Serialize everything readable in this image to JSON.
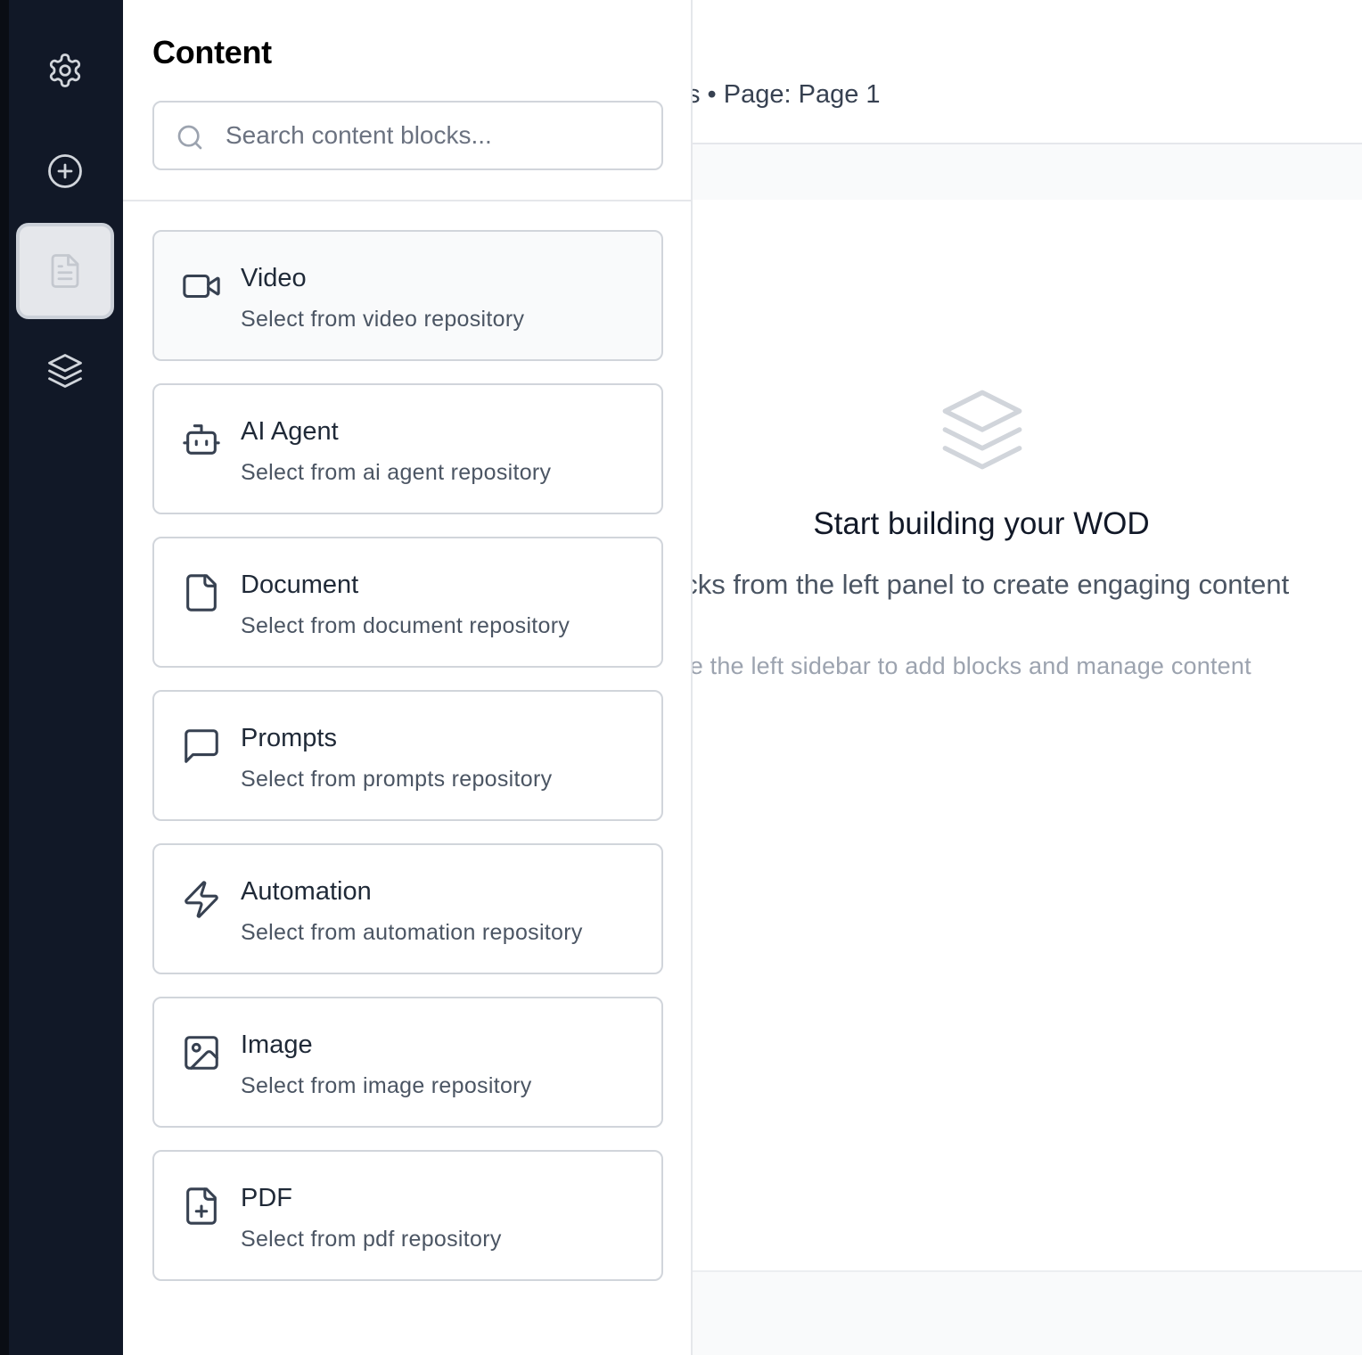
{
  "rail": {
    "items": [
      {
        "icon": "gear-icon",
        "active": false
      },
      {
        "icon": "plus-circle-icon",
        "active": false
      },
      {
        "icon": "document-icon",
        "active": true
      },
      {
        "icon": "layers-icon",
        "active": false
      }
    ],
    "colors": {
      "background": "#111827",
      "active_background": "#e5e7eb"
    }
  },
  "panel": {
    "title": "Content",
    "search": {
      "placeholder": "Search content blocks...",
      "value": ""
    },
    "cards": [
      {
        "icon": "video-icon",
        "title": "Video",
        "description": "Select from video repository"
      },
      {
        "icon": "bot-icon",
        "title": "AI Agent",
        "description": "Select from ai agent repository"
      },
      {
        "icon": "file-icon",
        "title": "Document",
        "description": "Select from document repository"
      },
      {
        "icon": "message-square-icon",
        "title": "Prompts",
        "description": "Select from prompts repository"
      },
      {
        "icon": "lightning-icon",
        "title": "Automation",
        "description": "Select from automation repository"
      },
      {
        "icon": "image-icon",
        "title": "Image",
        "description": "Select from image repository"
      },
      {
        "icon": "file-plus-icon",
        "title": "PDF",
        "description": "Select from pdf repository"
      }
    ]
  },
  "main": {
    "breadcrumb": "s • Page: Page 1",
    "empty_state": {
      "icon": "layers-icon",
      "title": "Start building your WOD",
      "description": "ocks from the left panel to create engaging content",
      "hint": "se the left sidebar to add blocks and manage content"
    }
  }
}
